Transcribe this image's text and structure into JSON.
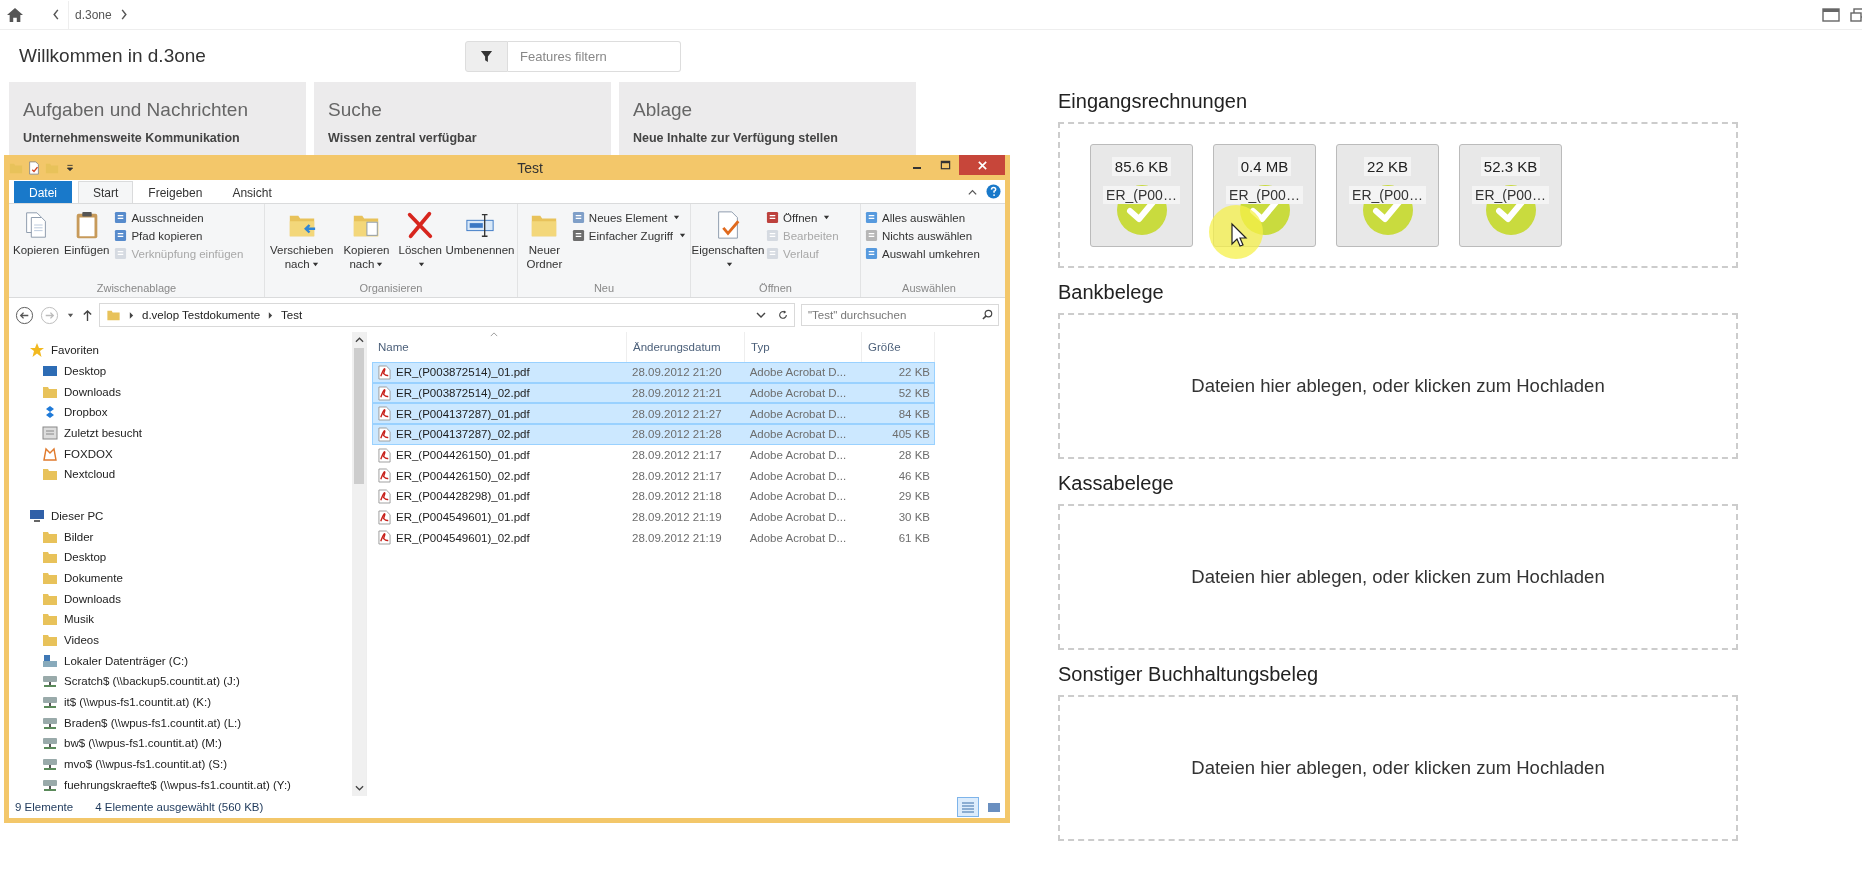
{
  "topbar": {
    "breadcrumb": "d.3one"
  },
  "page_title": "Willkommen in d.3one",
  "filter": {
    "placeholder": "Features filtern"
  },
  "tiles": [
    {
      "title": "Aufgaben und Nachrichten",
      "subtitle": "Unternehmensweite Kommunikation"
    },
    {
      "title": "Suche",
      "subtitle": "Wissen zentral verfügbar"
    },
    {
      "title": "Ablage",
      "subtitle": "Neue Inhalte zur Verfügung stellen"
    }
  ],
  "explorer": {
    "title": "Test",
    "ribbon_tabs": [
      {
        "label": "Datei",
        "kind": "file",
        "selected": false
      },
      {
        "label": "Start",
        "kind": "tab",
        "selected": true
      },
      {
        "label": "Freigeben",
        "kind": "tab",
        "selected": false
      },
      {
        "label": "Ansicht",
        "kind": "tab",
        "selected": false
      }
    ],
    "ribbon_groups": [
      {
        "label": "Zwischenablage",
        "large": [
          {
            "label": "Kopieren",
            "dropdown": false
          },
          {
            "label": "Einfügen",
            "dropdown": false
          }
        ],
        "small": [
          {
            "label": "Ausschneiden",
            "disabled": false,
            "dropdown": false
          },
          {
            "label": "Pfad kopieren",
            "disabled": false,
            "dropdown": false
          },
          {
            "label": "Verknüpfung einfügen",
            "disabled": true,
            "dropdown": false
          }
        ]
      },
      {
        "label": "Organisieren",
        "large": [
          {
            "label": "Verschieben nach",
            "dropdown": true
          },
          {
            "label": "Kopieren nach",
            "dropdown": true
          },
          {
            "label": "Löschen",
            "dropdown": true
          },
          {
            "label": "Umbenennen",
            "dropdown": false
          }
        ]
      },
      {
        "label": "Neu",
        "large": [
          {
            "label": "Neuer Ordner",
            "dropdown": false
          }
        ],
        "small": [
          {
            "label": "Neues Element",
            "disabled": false,
            "dropdown": true
          },
          {
            "label": "Einfacher Zugriff",
            "disabled": false,
            "dropdown": true
          }
        ]
      },
      {
        "label": "Öffnen",
        "large": [
          {
            "label": "Eigenschaften",
            "dropdown": true
          }
        ],
        "small": [
          {
            "label": "Öffnen",
            "disabled": false,
            "dropdown": true
          },
          {
            "label": "Bearbeiten",
            "disabled": true,
            "dropdown": false
          },
          {
            "label": "Verlauf",
            "disabled": true,
            "dropdown": false
          }
        ]
      },
      {
        "label": "Auswählen",
        "small": [
          {
            "label": "Alles auswählen",
            "disabled": false,
            "dropdown": false
          },
          {
            "label": "Nichts auswählen",
            "disabled": false,
            "dropdown": false
          },
          {
            "label": "Auswahl umkehren",
            "disabled": false,
            "dropdown": false
          }
        ]
      }
    ],
    "address": {
      "path": [
        "d.velop Testdokumente",
        "Test"
      ],
      "search_placeholder": "\"Test\" durchsuchen"
    },
    "nav": [
      {
        "label": "Favoriten",
        "kind": "star",
        "children": [
          {
            "label": "Desktop",
            "kind": "desktop"
          },
          {
            "label": "Downloads",
            "kind": "folder"
          },
          {
            "label": "Dropbox",
            "kind": "cloud"
          },
          {
            "label": "Zuletzt besucht",
            "kind": "recent"
          },
          {
            "label": "FOXDOX",
            "kind": "fox"
          },
          {
            "label": "Nextcloud",
            "kind": "folder"
          }
        ]
      },
      {
        "label": "Dieser PC",
        "kind": "pc",
        "children": [
          {
            "label": "Bilder",
            "kind": "folder"
          },
          {
            "label": "Desktop",
            "kind": "folder"
          },
          {
            "label": "Dokumente",
            "kind": "folder"
          },
          {
            "label": "Downloads",
            "kind": "folder"
          },
          {
            "label": "Musik",
            "kind": "folder"
          },
          {
            "label": "Videos",
            "kind": "folder"
          },
          {
            "label": "Lokaler Datenträger (C:)",
            "kind": "disk"
          },
          {
            "label": "Scratch$ (\\\\backup5.countit.at) (J:)",
            "kind": "network"
          },
          {
            "label": "it$ (\\\\wpus-fs1.countit.at) (K:)",
            "kind": "network"
          },
          {
            "label": "Braden$ (\\\\wpus-fs1.countit.at) (L:)",
            "kind": "network"
          },
          {
            "label": "bw$ (\\\\wpus-fs1.countit.at) (M:)",
            "kind": "network"
          },
          {
            "label": "mvo$ (\\\\wpus-fs1.countit.at) (S:)",
            "kind": "network"
          },
          {
            "label": "fuehrungskraefte$ (\\\\wpus-fs1.countit.at) (Y:)",
            "kind": "network"
          }
        ]
      }
    ],
    "columns": [
      "Name",
      "Änderungsdatum",
      "Typ",
      "Größe"
    ],
    "files": [
      {
        "name": "ER_(P003872514)_01.pdf",
        "modified": "28.09.2012 21:20",
        "type": "Adobe Acrobat D...",
        "size": "22 KB",
        "selected": true
      },
      {
        "name": "ER_(P003872514)_02.pdf",
        "modified": "28.09.2012 21:21",
        "type": "Adobe Acrobat D...",
        "size": "52 KB",
        "selected": true
      },
      {
        "name": "ER_(P004137287)_01.pdf",
        "modified": "28.09.2012 21:27",
        "type": "Adobe Acrobat D...",
        "size": "84 KB",
        "selected": true
      },
      {
        "name": "ER_(P004137287)_02.pdf",
        "modified": "28.09.2012 21:28",
        "type": "Adobe Acrobat D...",
        "size": "405 KB",
        "selected": true
      },
      {
        "name": "ER_(P004426150)_01.pdf",
        "modified": "28.09.2012 21:17",
        "type": "Adobe Acrobat D...",
        "size": "28 KB",
        "selected": false
      },
      {
        "name": "ER_(P004426150)_02.pdf",
        "modified": "28.09.2012 21:17",
        "type": "Adobe Acrobat D...",
        "size": "46 KB",
        "selected": false
      },
      {
        "name": "ER_(P004428298)_01.pdf",
        "modified": "28.09.2012 21:18",
        "type": "Adobe Acrobat D...",
        "size": "29 KB",
        "selected": false
      },
      {
        "name": "ER_(P004549601)_01.pdf",
        "modified": "28.09.2012 21:19",
        "type": "Adobe Acrobat D...",
        "size": "30 KB",
        "selected": false
      },
      {
        "name": "ER_(P004549601)_02.pdf",
        "modified": "28.09.2012 21:19",
        "type": "Adobe Acrobat D...",
        "size": "61 KB",
        "selected": false
      }
    ],
    "status": {
      "count": "9 Elemente",
      "selection": "4 Elemente ausgewählt (560 KB)"
    },
    "views": [
      {
        "kind": "details",
        "selected": true
      },
      {
        "kind": "tiles",
        "selected": false
      }
    ]
  },
  "sections": [
    {
      "heading": "Eingangsrechnungen",
      "files": [
        {
          "size": "85.6 KB",
          "name": "ER_(P00…",
          "uploaded": true
        },
        {
          "size": "0.4 MB",
          "name": "ER_(P00…",
          "uploaded": true
        },
        {
          "size": "22 KB",
          "name": "ER_(P00…",
          "uploaded": true
        },
        {
          "size": "52.3 KB",
          "name": "ER_(P00…",
          "uploaded": true
        }
      ]
    },
    {
      "heading": "Bankbelege",
      "prompt": "Dateien hier ablegen, oder klicken zum Hochladen"
    },
    {
      "heading": "Kassabelege",
      "prompt": "Dateien hier ablegen, oder klicken zum Hochladen"
    },
    {
      "heading": "Sonstiger Buchhaltungsbeleg",
      "prompt": "Dateien hier ablegen, oder klicken zum Hochladen"
    }
  ]
}
